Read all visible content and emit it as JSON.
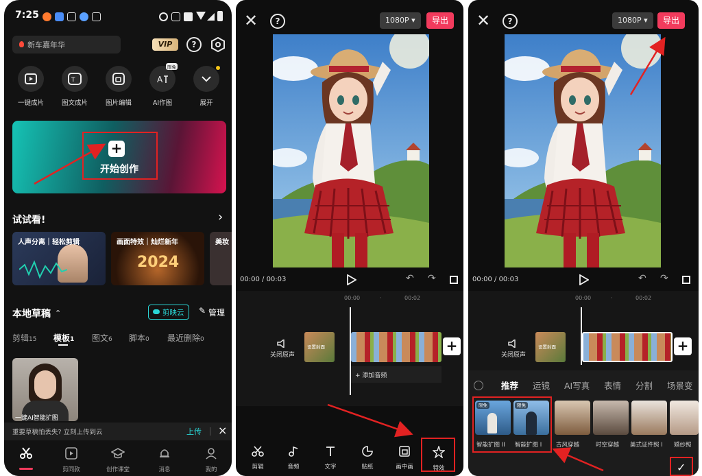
{
  "home": {
    "status_time": "7:25",
    "promo_label": "新车嘉年华",
    "vip_label": "VIP",
    "help_glyph": "?",
    "settings_icon": "settings-hex-icon",
    "tools": [
      {
        "label": "一键成片",
        "icon": "play-icon"
      },
      {
        "label": "图文成片",
        "icon": "text-ai-icon"
      },
      {
        "label": "图片编辑",
        "icon": "image-edit-icon"
      },
      {
        "label": "AI作图",
        "icon": "ai-draw-icon",
        "badge": "限免"
      },
      {
        "label": "展开",
        "icon": "chevron-down-icon"
      }
    ],
    "create_plus": "+",
    "create_label": "开始创作",
    "try_title": "试试看!",
    "try_arrow": "›",
    "try_cards": [
      {
        "label": "人声分离｜轻松剪辑"
      },
      {
        "label": "画面特效｜灿烂新年",
        "overlay": "2024"
      },
      {
        "label": "美妆"
      }
    ],
    "drafts_title": "本地草稿",
    "drafts_caret": "⌃",
    "cloud_label": "剪映云",
    "manage_label": "管理",
    "draft_tabs": [
      {
        "label": "剪辑",
        "count": "15"
      },
      {
        "label": "模板",
        "count": "1"
      },
      {
        "label": "图文",
        "count": "6"
      },
      {
        "label": "脚本",
        "count": "0"
      },
      {
        "label": "最近删除",
        "count": "0"
      }
    ],
    "draft_caption": "一键AI智能扩图",
    "warn_text": "重要草稿怕丢失? 立刻上传到云",
    "upload_label": "上传",
    "close_glyph": "×",
    "nav": [
      {
        "label": "剪辑",
        "icon": "scissors-icon"
      },
      {
        "label": "剪同款",
        "icon": "template-icon"
      },
      {
        "label": "创作课堂",
        "icon": "graduation-icon"
      },
      {
        "label": "消息",
        "icon": "bell-icon"
      },
      {
        "label": "我的",
        "icon": "profile-icon"
      }
    ]
  },
  "editor": {
    "close_glyph": "✕",
    "help_glyph": "?",
    "resolution": "1080P ▾",
    "export_label": "导出",
    "time_current": "00:00",
    "time_total": "/ 00:03",
    "ruler_marks": [
      "00:00",
      "·",
      "00:02"
    ],
    "mute_label": "关闭原声",
    "add_audio": "+ 添加音频",
    "plus_glyph": "+",
    "cover_label": "设置封面",
    "bottom_tools": [
      {
        "label": "剪辑",
        "icon": "scissors-icon"
      },
      {
        "label": "音频",
        "icon": "music-note-icon"
      },
      {
        "label": "文字",
        "icon": "text-t-icon"
      },
      {
        "label": "贴纸",
        "icon": "sticker-icon"
      },
      {
        "label": "画中画",
        "icon": "pip-icon"
      },
      {
        "label": "特效",
        "icon": "sparkle-star-icon"
      }
    ],
    "effect_tabs": [
      "推荐",
      "运镜",
      "AI写真",
      "表情",
      "分割",
      "场景变"
    ],
    "effects": [
      {
        "label": "智能扩图 II",
        "badge": "限免"
      },
      {
        "label": "智能扩图 I",
        "badge": "限免"
      },
      {
        "label": "古风穿越"
      },
      {
        "label": "时空穿越"
      },
      {
        "label": "美式证件照 I"
      },
      {
        "label": "婚纱照"
      }
    ],
    "confirm_glyph": "✓"
  },
  "colors": {
    "accent_red": "#f23b5d",
    "highlight_box": "#e22222",
    "cloud_teal": "#2ad4d4"
  }
}
